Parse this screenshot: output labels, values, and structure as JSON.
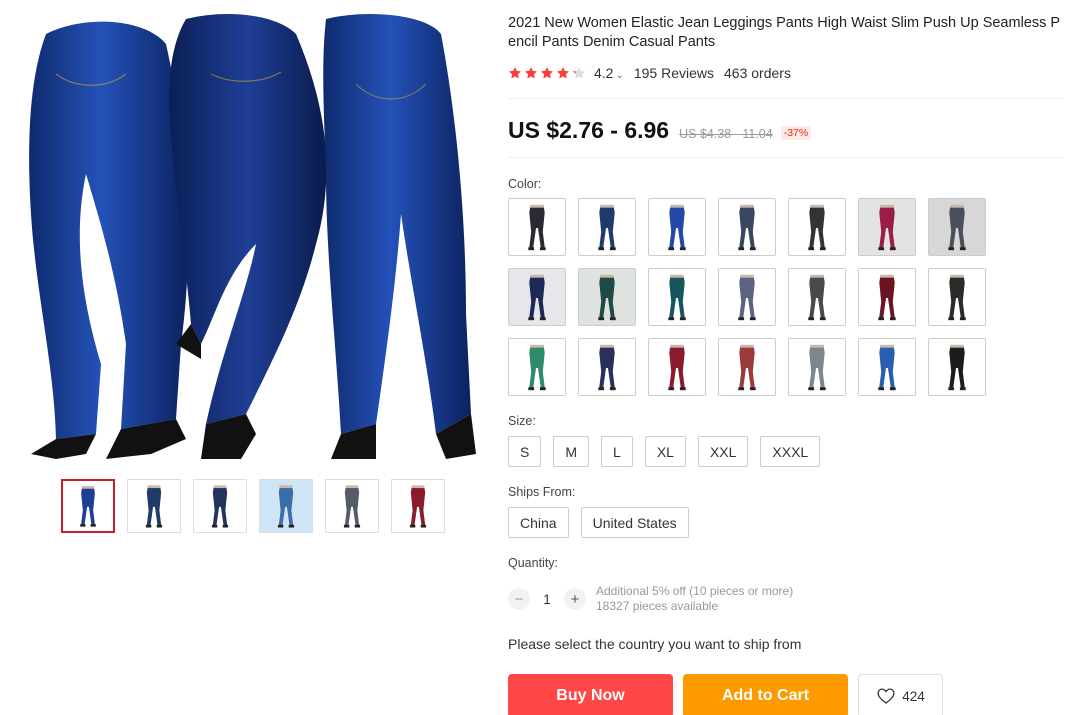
{
  "product": {
    "title": "2021 New Women Elastic Jean Leggings Pants High Waist Slim Push Up Seamless Pencil Pants Denim Casual Pants",
    "rating": "4.2",
    "rating_value": 4.2,
    "reviews": "195 Reviews",
    "orders": "463 orders",
    "price": "US $2.76 - 6.96",
    "old_price": "US $4.38 - 11.04",
    "discount": "-37%"
  },
  "colors": {
    "star_filled": "#f44336",
    "star_empty": "#dddddd",
    "buy_now": "#ff4747",
    "add_to_cart": "#ff9900",
    "thumb_active_border": "#c7202b",
    "discount_text": "#e62e04"
  },
  "gallery": {
    "thumbs": [
      {
        "name": "three-models-denim",
        "active": true
      },
      {
        "name": "pose-side"
      },
      {
        "name": "detail-closeup"
      },
      {
        "name": "fabric-feature"
      },
      {
        "name": "multi-color-set"
      },
      {
        "name": "color-range"
      }
    ]
  },
  "color_label": "Color:",
  "color_swatches": [
    {
      "label": "style-1",
      "pant": "#2a2a35",
      "bg": "#ffffff"
    },
    {
      "label": "style-2",
      "pant": "#1e3b6b",
      "bg": "#ffffff"
    },
    {
      "label": "style-3",
      "pant": "#2448a8",
      "bg": "#ffffff"
    },
    {
      "label": "style-4",
      "pant": "#3a4560",
      "bg": "#ffffff"
    },
    {
      "label": "style-5",
      "pant": "#333333",
      "bg": "#ffffff"
    },
    {
      "label": "style-6",
      "pant": "#9b1c45",
      "bg": "#e3e3e3"
    },
    {
      "label": "style-7",
      "pant": "#4a4f5e",
      "bg": "#d7d7d7"
    },
    {
      "label": "style-8",
      "pant": "#1d2a55",
      "bg": "#e6e6ec"
    },
    {
      "label": "style-9",
      "pant": "#1f4a45",
      "bg": "#dfe3e0"
    },
    {
      "label": "style-10",
      "pant": "#17565c",
      "bg": "#ffffff"
    },
    {
      "label": "style-11",
      "pant": "#5a6480",
      "bg": "#ffffff"
    },
    {
      "label": "style-12",
      "pant": "#4a4a4a",
      "bg": "#ffffff"
    },
    {
      "label": "style-13",
      "pant": "#6b1422",
      "bg": "#ffffff"
    },
    {
      "label": "style-14",
      "pant": "#2b2b2b",
      "bg": "#ffffff"
    },
    {
      "label": "style-15",
      "pant": "#2e8a68",
      "bg": "#ffffff"
    },
    {
      "label": "style-16",
      "pant": "#27315a",
      "bg": "#ffffff"
    },
    {
      "label": "style-17",
      "pant": "#8a1a2c",
      "bg": "#ffffff"
    },
    {
      "label": "style-18",
      "pant": "#9c3a3a",
      "bg": "#ffffff"
    },
    {
      "label": "style-19",
      "pant": "#7c8590",
      "bg": "#ffffff"
    },
    {
      "label": "style-20",
      "pant": "#2a5fb0",
      "bg": "#ffffff"
    },
    {
      "label": "style-21",
      "pant": "#1c1c1c",
      "bg": "#ffffff"
    }
  ],
  "size_label": "Size:",
  "sizes": [
    "S",
    "M",
    "L",
    "XL",
    "XXL",
    "XXXL"
  ],
  "ships_from_label": "Ships From:",
  "ships_from": [
    "China",
    "United States"
  ],
  "quantity": {
    "label": "Quantity:",
    "minus": "−",
    "value": "1",
    "plus": "+",
    "discount_note": "Additional 5% off (10 pieces or more)",
    "available": "18327 pieces available"
  },
  "ship_note": "Please select the country you want to ship from",
  "actions": {
    "buy_now": "Buy Now",
    "add_to_cart": "Add to Cart",
    "wishlist_count": "424"
  }
}
